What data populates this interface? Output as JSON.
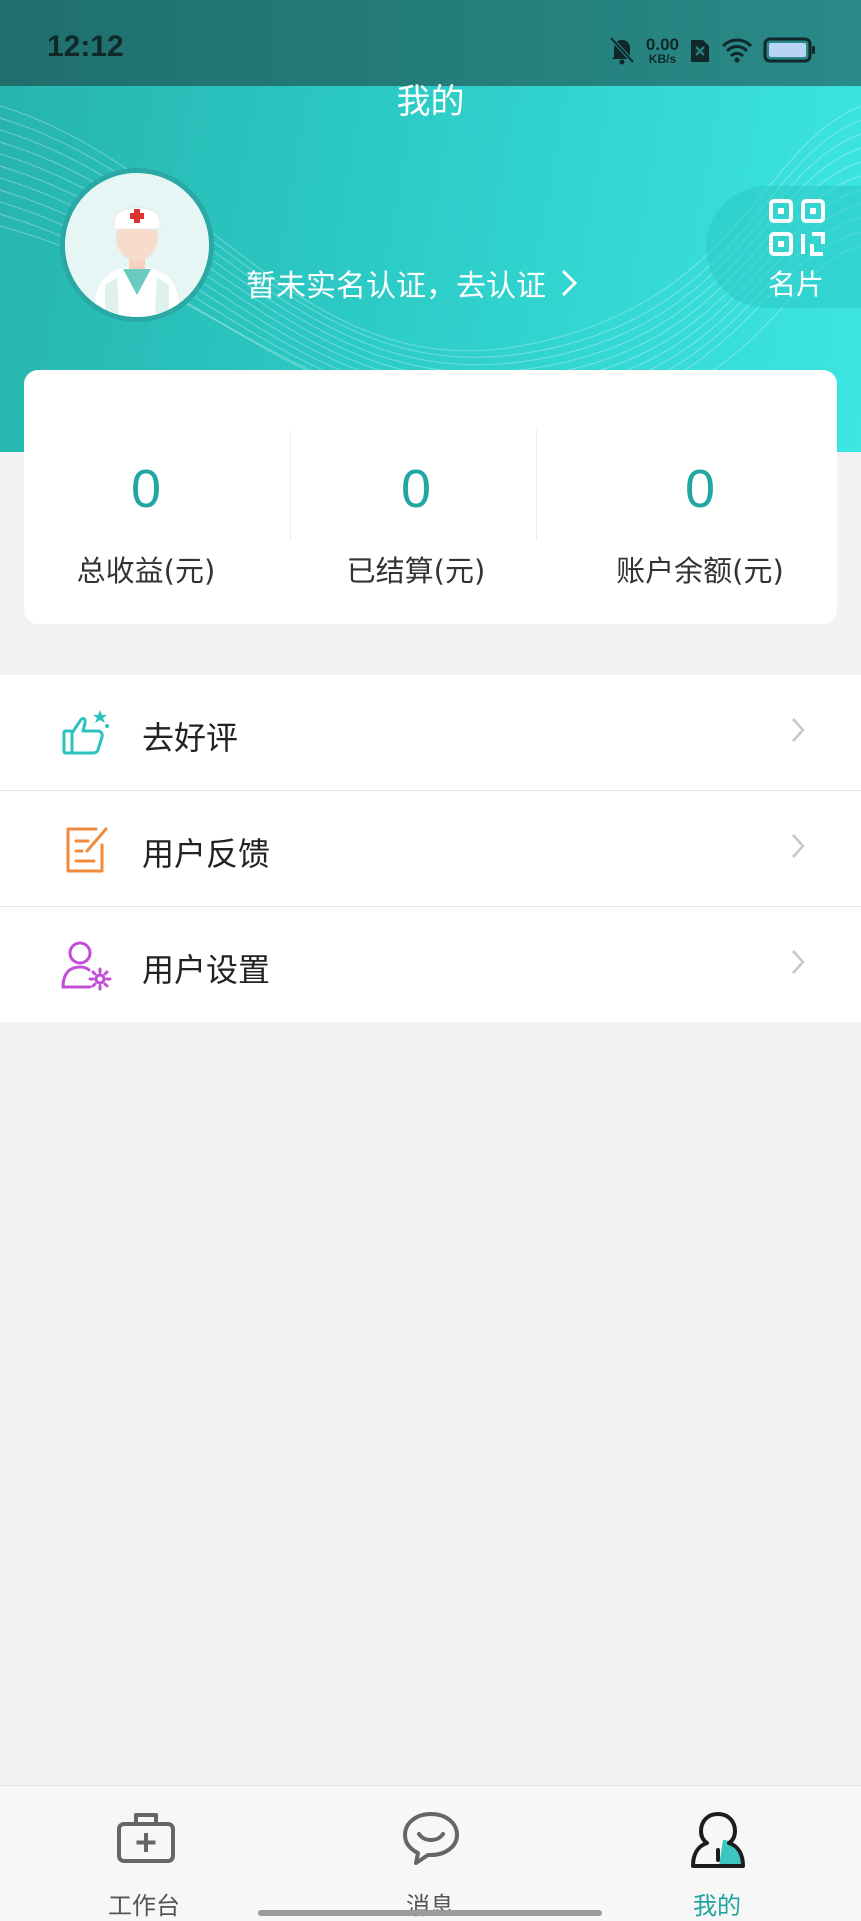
{
  "status_bar": {
    "time": "12:12",
    "net_speed": "0.00",
    "net_unit": "KB/s"
  },
  "header": {
    "title": "我的",
    "verify_text": "暂未实名认证，去认证",
    "card_button_label": "名片"
  },
  "stats": [
    {
      "value": "0",
      "label": "总收益(元)"
    },
    {
      "value": "0",
      "label": "已结算(元)"
    },
    {
      "value": "0",
      "label": "账户余额(元)"
    }
  ],
  "menu": [
    {
      "label": "去好评",
      "icon": "thumbs-up-icon",
      "color": "#2cc2bd"
    },
    {
      "label": "用户反馈",
      "icon": "feedback-edit-icon",
      "color": "#f08a3c"
    },
    {
      "label": "用户设置",
      "icon": "user-settings-icon",
      "color": "#c34fd6"
    }
  ],
  "tabs": [
    {
      "label": "工作台",
      "icon": "medical-kit-icon",
      "active": false
    },
    {
      "label": "消息",
      "icon": "chat-bubble-icon",
      "active": false
    },
    {
      "label": "我的",
      "icon": "profile-icon",
      "active": true
    }
  ],
  "colors": {
    "accent": "#22a6a3",
    "header_start": "#27b3ad",
    "header_end": "#3de6e3"
  }
}
